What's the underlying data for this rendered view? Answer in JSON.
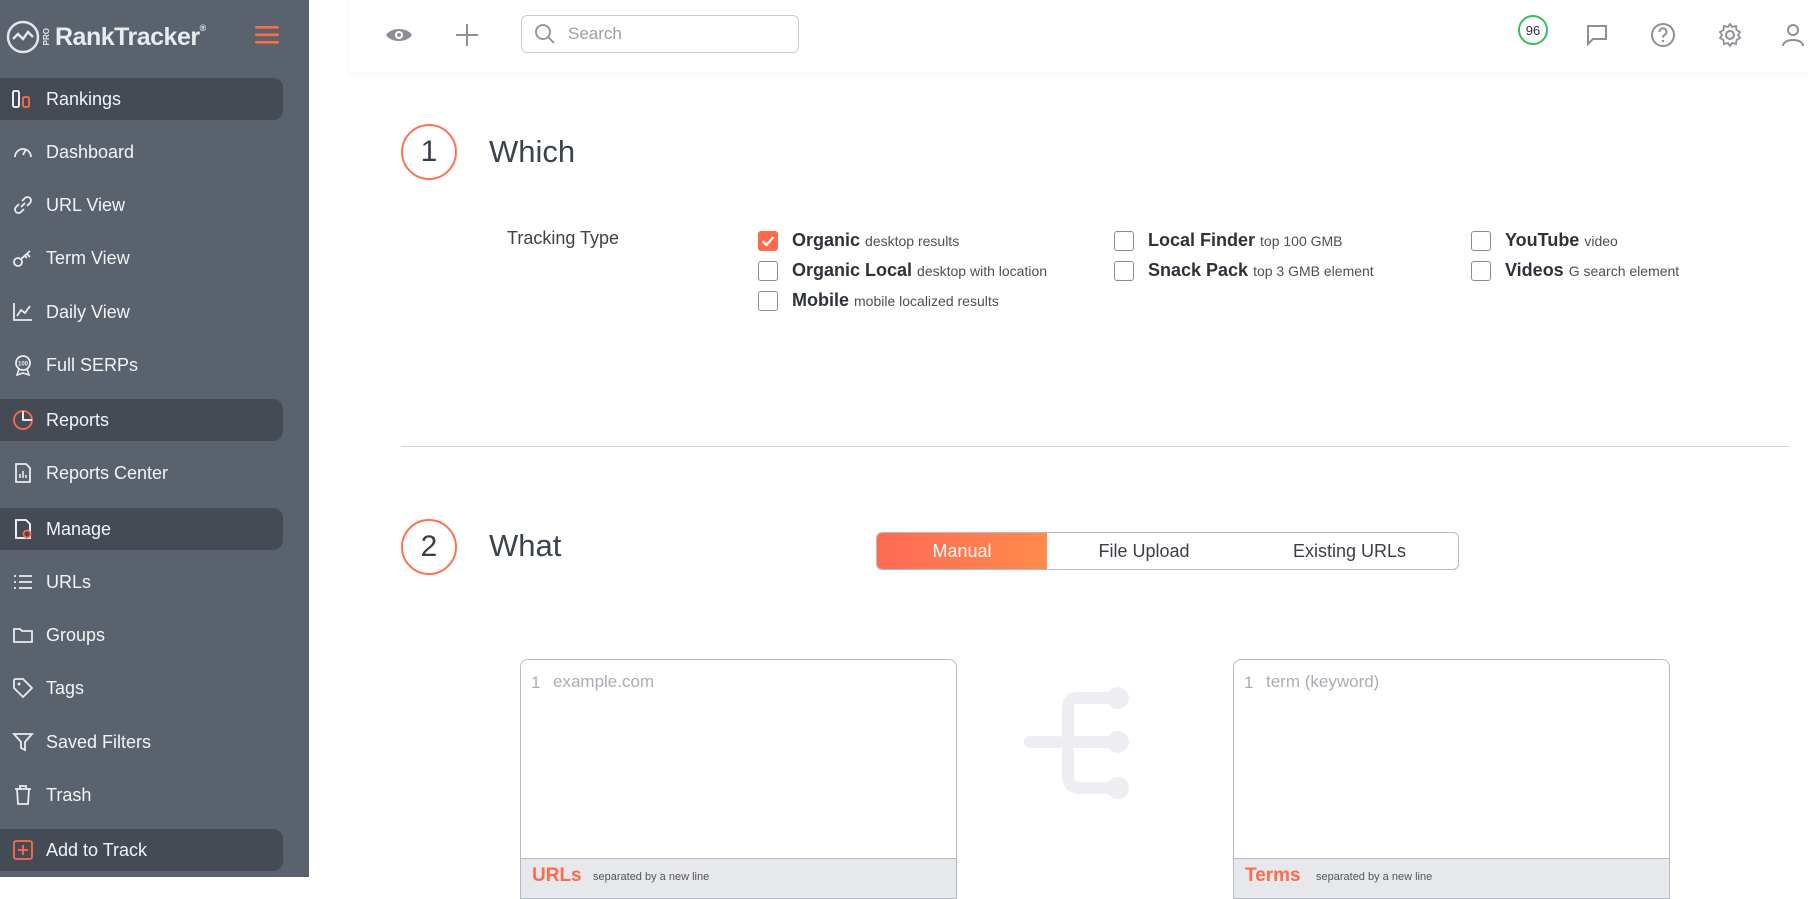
{
  "app": {
    "logo_text": "RankTracker",
    "logo_badge": "PRO",
    "logo_mark": "®"
  },
  "sidebar": {
    "items": [
      {
        "label": "Rankings",
        "icon": "rankings-icon",
        "section": true
      },
      {
        "label": "Dashboard",
        "icon": "gauge-icon",
        "section": false
      },
      {
        "label": "URL View",
        "icon": "link-icon",
        "section": false
      },
      {
        "label": "Term View",
        "icon": "key-icon",
        "section": false
      },
      {
        "label": "Daily View",
        "icon": "line-chart-icon",
        "section": false
      },
      {
        "label": "Full SERPs",
        "icon": "award-100-icon",
        "section": false
      },
      {
        "label": "Reports",
        "icon": "pie-chart-icon",
        "section": true
      },
      {
        "label": "Reports Center",
        "icon": "report-file-icon",
        "section": false
      },
      {
        "label": "Manage",
        "icon": "manage-file-icon",
        "section": true
      },
      {
        "label": "URLs",
        "icon": "list-icon",
        "section": false
      },
      {
        "label": "Groups",
        "icon": "folder-icon",
        "section": false
      },
      {
        "label": "Tags",
        "icon": "tag-icon",
        "section": false
      },
      {
        "label": "Saved Filters",
        "icon": "filter-icon",
        "section": false
      },
      {
        "label": "Trash",
        "icon": "trash-icon",
        "section": false
      },
      {
        "label": "Add to Track",
        "icon": "plus-square-icon",
        "section": true
      }
    ]
  },
  "topbar": {
    "search_placeholder": "Search",
    "score": "96"
  },
  "step1": {
    "number": "1",
    "title": "Which",
    "tracking_label": "Tracking Type",
    "options": [
      {
        "name": "Organic",
        "desc": "desktop results",
        "checked": true
      },
      {
        "name": "Organic Local",
        "desc": "desktop with location",
        "checked": false
      },
      {
        "name": "Mobile",
        "desc": "mobile localized results",
        "checked": false
      },
      {
        "name": "Local Finder",
        "desc": "top 100 GMB",
        "checked": false
      },
      {
        "name": "Snack Pack",
        "desc": "top 3 GMB element",
        "checked": false
      },
      {
        "name": "YouTube",
        "desc": "video",
        "checked": false
      },
      {
        "name": "Videos",
        "desc": "G search element",
        "checked": false
      }
    ]
  },
  "step2": {
    "number": "2",
    "title": "What",
    "tabs": [
      "Manual",
      "File Upload",
      "Existing URLs"
    ],
    "active_tab": "Manual",
    "urls_editor": {
      "line_number": "1",
      "placeholder": "example.com",
      "footer_title": "URLs",
      "footer_note": "separated by a new line"
    },
    "terms_editor": {
      "line_number": "1",
      "placeholder": "term (keyword)",
      "footer_title": "Terms",
      "footer_note": "separated by a new line"
    }
  },
  "colors": {
    "sidebar_bg": "#5a626e",
    "sidebar_section_bg": "#444b55",
    "accent": "#ff6b4a",
    "score_ring": "#35c05a"
  }
}
